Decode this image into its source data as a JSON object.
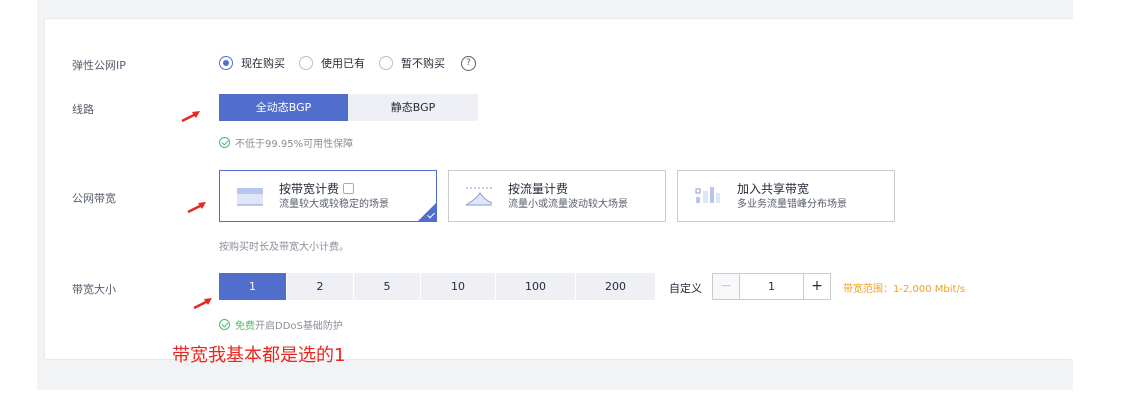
{
  "eip": {
    "label": "弹性公网IP",
    "options": [
      "现在购买",
      "使用已有",
      "暂不购买"
    ],
    "selected": "现在购买",
    "help_icon": "question-circle-icon"
  },
  "line": {
    "label": "线路",
    "options": [
      "全动态BGP",
      "静态BGP"
    ],
    "selected": "全动态BGP",
    "note": "不低于99.95%可用性保障"
  },
  "bandwidth_type": {
    "label": "公网带宽",
    "cards": [
      {
        "title": "按带宽计费",
        "desc": "流量较大或较稳定的场景",
        "selected": true,
        "icon": "bandwidth-chart-icon",
        "badge_icon": "thumbs-up-icon"
      },
      {
        "title": "按流量计费",
        "desc": "流量小或流量波动较大场景",
        "selected": false,
        "icon": "traffic-chart-icon"
      },
      {
        "title": "加入共享带宽",
        "desc": "多业务流量错峰分布场景",
        "selected": false,
        "icon": "shared-bandwidth-icon"
      }
    ],
    "note": "按购买时长及带宽大小计费。"
  },
  "bandwidth_size": {
    "label": "带宽大小",
    "options": [
      "1",
      "2",
      "5",
      "10",
      "100",
      "200"
    ],
    "selected": "1",
    "custom_label": "自定义",
    "custom_value": "1",
    "range_text": "带宽范围：1-2,000 Mbit/s",
    "note_free": "免费",
    "note_rest": "开启DDoS基础防护"
  },
  "annotation": {
    "text": "带宽我基本都是选的1",
    "color": "#e8271e"
  },
  "colors": {
    "accent": "#526ecc",
    "success": "#50b96a",
    "warning": "#f0a020"
  }
}
